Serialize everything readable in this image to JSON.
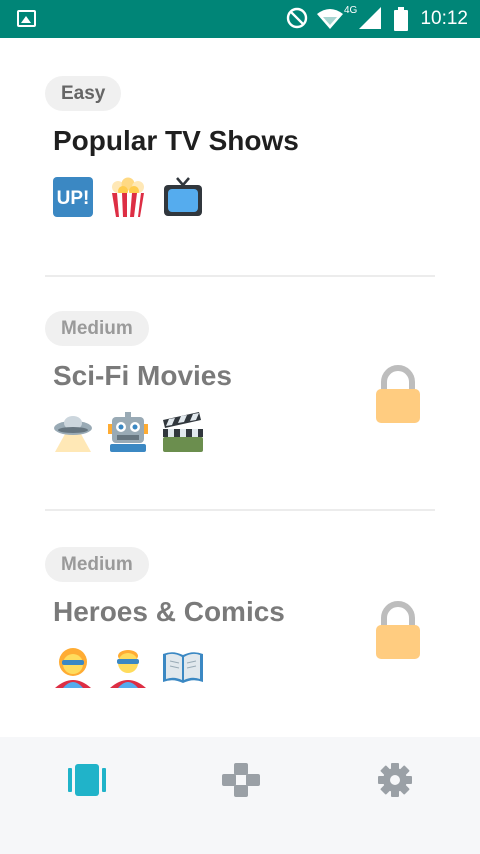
{
  "status_bar": {
    "time": "10:12",
    "network": "4G",
    "icons": [
      "gallery-icon",
      "do-not-disturb-icon",
      "wifi-icon",
      "signal-icon",
      "battery-icon"
    ]
  },
  "categories": [
    {
      "difficulty": "Easy",
      "title": "Popular TV Shows",
      "emojis": [
        "up-button-icon",
        "popcorn-icon",
        "television-icon"
      ],
      "up_text": "UP!",
      "locked": false
    },
    {
      "difficulty": "Medium",
      "title": "Sci-Fi Movies",
      "emojis": [
        "ufo-icon",
        "robot-icon",
        "clapper-board-icon"
      ],
      "locked": true
    },
    {
      "difficulty": "Medium",
      "title": "Heroes & Comics",
      "emojis": [
        "superhero-woman-icon",
        "superhero-man-icon",
        "open-book-icon"
      ],
      "locked": true
    }
  ],
  "bottom_nav": {
    "items": [
      "cards-icon",
      "gamepad-icon",
      "settings-icon"
    ],
    "active_color": "#20b3c9",
    "inactive_color": "#9aa0a6"
  },
  "colors": {
    "status_bar": "#008577",
    "lock": "#ffcc80"
  }
}
